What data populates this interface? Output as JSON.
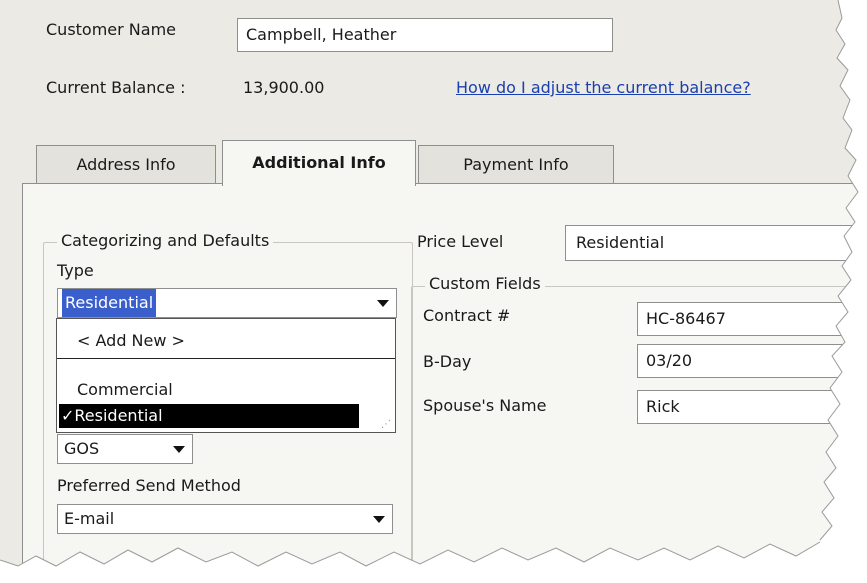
{
  "customer": {
    "name_label": "Customer Name",
    "name_value": "Campbell, Heather",
    "balance_label": "Current Balance :",
    "balance_value": "13,900.00",
    "adjust_link": "How do I adjust the current balance?"
  },
  "tabs": [
    {
      "label": "Address Info",
      "active": false
    },
    {
      "label": "Additional Info",
      "active": true
    },
    {
      "label": "Payment Info",
      "active": false
    }
  ],
  "categorizing": {
    "title": "Categorizing and Defaults",
    "type_label": "Type",
    "type_value": "Residential",
    "dropdown_options": [
      "< Add New >",
      "Commercial",
      "Residential"
    ],
    "dropdown_selected": "Residential",
    "rep_value": "GOS",
    "send_method_label": "Preferred Send Method",
    "send_method_value": "E-mail"
  },
  "price_level": {
    "label": "Price Level",
    "value": "Residential"
  },
  "custom_fields": {
    "title": "Custom Fields",
    "fields": [
      {
        "label": "Contract #",
        "value": "HC-86467"
      },
      {
        "label": "B-Day",
        "value": "03/20"
      },
      {
        "label": "Spouse's Name",
        "value": "Rick"
      }
    ]
  },
  "colors": {
    "window_bg": "#eceae4",
    "panel_bg": "#f6f6f3",
    "link": "#1a3fb0",
    "selection_highlight": "#3a5fcd",
    "dropdown_selected_bg": "#000000"
  }
}
